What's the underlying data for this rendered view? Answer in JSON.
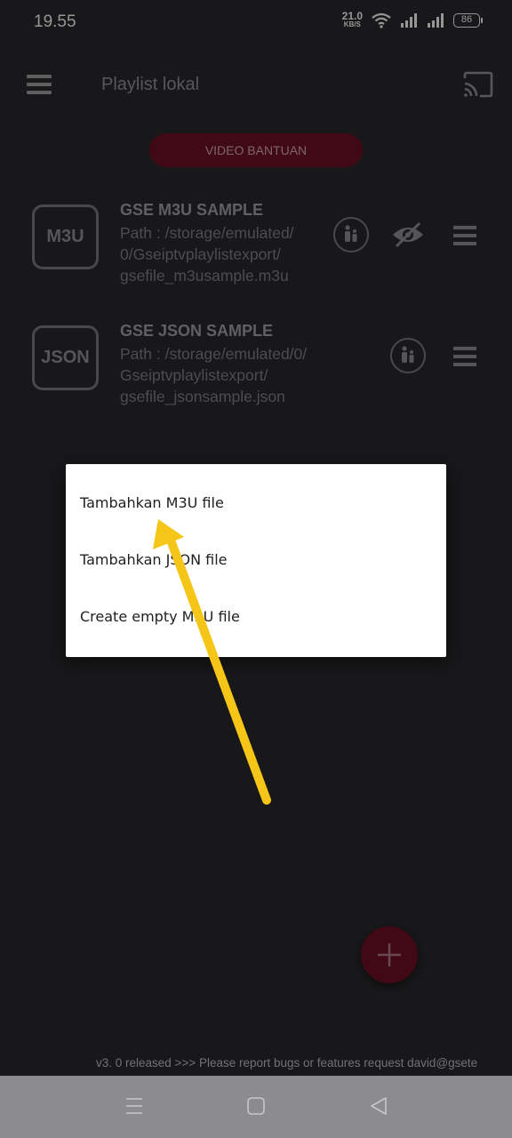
{
  "status": {
    "time": "19.55",
    "net_speed_value": "21.0",
    "net_speed_unit": "KB/S",
    "battery": "86"
  },
  "app_bar": {
    "title": "Playlist lokal"
  },
  "help_button": {
    "label": "VIDEO BANTUAN"
  },
  "playlists": [
    {
      "badge": "M3U",
      "name": "GSE M3U SAMPLE",
      "path_lines": [
        "Path : /storage/emulated/",
        "0/Gseiptvplaylistexport/",
        "gsefile_m3usample.m3u"
      ]
    },
    {
      "badge": "JSON",
      "name": "GSE JSON SAMPLE",
      "path_lines": [
        "Path : /storage/emulated/0/",
        "Gseiptvplaylistexport/",
        "gsefile_jsonsample.json"
      ]
    }
  ],
  "dialog": {
    "options": [
      "Tambahkan M3U file",
      "Tambahkan JSON file",
      "Create empty M3U file"
    ]
  },
  "ticker": {
    "text": "v3. 0 released >>>  Please report bugs or features request david@gsete"
  },
  "colors": {
    "accent": "#6a0f22",
    "arrow": "#f5c518",
    "background": "#27272a"
  },
  "icons": {
    "menu": "menu-icon",
    "cast": "cast-icon",
    "parental": "parental-lock-icon",
    "visibility": "eye-icon",
    "add": "plus-icon"
  }
}
